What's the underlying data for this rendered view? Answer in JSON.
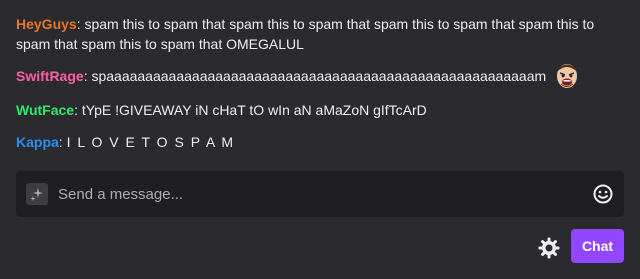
{
  "messages": [
    {
      "username": "HeyGuys",
      "color": "#e8762b",
      "text": "spam this to spam that spam this to spam that spam this to spam that spam this to spam that spam this to spam that OMEGALUL"
    },
    {
      "username": "SwiftRage",
      "color": "#ff5fa7",
      "text": "spaaaaaaaaaaaaaaaaaaaaaaaaaaaaaaaaaaaaaaaaaaaaaaaaaaaaaaam",
      "emote": "swiftrage-emote"
    },
    {
      "username": "WutFace",
      "color": "#2ee86c",
      "text": "tYpE !GIVEAWAY iN cHaT tO wIn aN aMaZoN gIfTcArD"
    },
    {
      "username": "Kappa",
      "color": "#2e8ef2",
      "text": "I L O V E T O S P A M"
    }
  ],
  "input": {
    "placeholder": "Send a message..."
  },
  "chat_button_label": "Chat",
  "colors": {
    "background": "#2b2b2f",
    "input_background": "#1f1f23",
    "accent": "#9147ff"
  },
  "icons": {
    "input_left": "sparkle-icon",
    "emoji": "smiley-icon",
    "settings": "gear-icon"
  }
}
